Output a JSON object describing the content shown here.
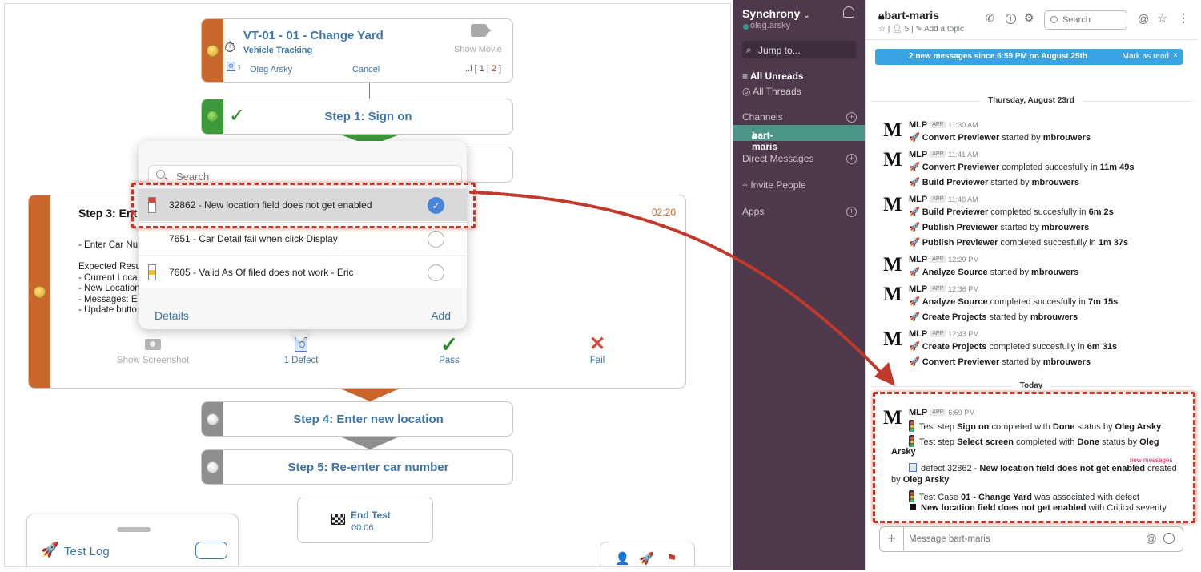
{
  "runner": {
    "test_card": {
      "title": "VT-01 - 01 - Change Yard",
      "subtitle": "Vehicle Tracking",
      "show_movie": "Show Movie",
      "defect_count": "1",
      "user": "Oleg Arsky",
      "cancel": "Cancel",
      "pages_prefix": "..l [ 1 | ",
      "pages_current": "2",
      "pages_suffix": " ]"
    },
    "steps": {
      "step1": "Step 1: Sign on",
      "step3_title": "Step 3: Ent",
      "step3_time": "02:20",
      "step3_body": "- Enter Car Nu\n\nExpected Resu\n- Current Loca\n- New Location\n- Messages: E\n- Update butto",
      "step4": "Step 4: Enter new location",
      "step5": "Step 5: Re-enter car number"
    },
    "actions": {
      "screenshot": "Show Screenshot",
      "defect": "1 Defect",
      "pass": "Pass",
      "fail": "Fail"
    },
    "end_test": {
      "label": "End Test",
      "time": "00:06"
    },
    "test_log": "Test Log",
    "popover": {
      "search_placeholder": "Search",
      "defects": [
        {
          "text": "32862 - New location field does not get enabled",
          "flag": "red",
          "selected": true
        },
        {
          "text": "7651 - Car Detail fail when click Display",
          "flag": "none",
          "selected": false
        },
        {
          "text": "7605 - Valid As Of filed does not work - Eric",
          "flag": "yellow",
          "selected": false
        }
      ],
      "details": "Details",
      "add": "Add"
    }
  },
  "slack": {
    "workspace": "Synchrony",
    "workspace_caret": "⌄",
    "user": "oleg.arsky",
    "jump_to": "Jump to...",
    "nav": {
      "unreads": "All Unreads",
      "threads": "All Threads"
    },
    "sections": {
      "channels": "Channels",
      "dms": "Direct Messages",
      "invite": "Invite People",
      "apps": "Apps"
    },
    "active_channel": "bart-maris",
    "channel": {
      "name": "bart-maris",
      "members": "5",
      "add_topic": "Add a topic"
    },
    "search_placeholder": "Search",
    "banner": {
      "text": "2 new messages since 6:59 PM on August 25th",
      "mark": "Mark as read",
      "close": "×"
    },
    "days": {
      "thursday": "Thursday, August 23rd",
      "today": "Today"
    },
    "author": "MLP",
    "app_badge": "APP",
    "messages": [
      {
        "time": "11:30 AM",
        "lines": [
          {
            "b1": "Convert Previewer",
            "t1": " started by ",
            "b2": "mbrouwers"
          }
        ]
      },
      {
        "time": "11:41 AM",
        "lines": [
          {
            "b1": "Convert Previewer",
            "t1": " completed succesfully in ",
            "b2": "11m 49s"
          },
          {
            "b1": "Build Previewer",
            "t1": " started by ",
            "b2": "mbrouwers"
          }
        ]
      },
      {
        "time": "11:48 AM",
        "lines": [
          {
            "b1": "Build Previewer",
            "t1": " completed succesfully in ",
            "b2": "6m 2s"
          },
          {
            "b1": "Publish Previewer",
            "t1": " started by ",
            "b2": "mbrouwers"
          },
          {
            "b1": "Publish Previewer",
            "t1": " completed succesfully in ",
            "b2": "1m 37s"
          }
        ]
      },
      {
        "time": "12:29 PM",
        "lines": [
          {
            "b1": "Analyze Source",
            "t1": " started by ",
            "b2": "mbrouwers"
          }
        ]
      },
      {
        "time": "12:36 PM",
        "lines": [
          {
            "b1": "Analyze Source",
            "t1": " completed succesfully in ",
            "b2": "7m 15s"
          },
          {
            "b1": "Create Projects",
            "t1": " started by ",
            "b2": "mbrouwers"
          }
        ]
      },
      {
        "time": "12:43 PM",
        "lines": [
          {
            "b1": "Create Projects",
            "t1": " completed succesfully in ",
            "b2": "6m 31s"
          },
          {
            "b1": "Convert Previewer",
            "t1": " started by ",
            "b2": "mbrouwers"
          }
        ]
      }
    ],
    "today_message": {
      "time": "6:59 PM",
      "l1": {
        "a": "Test step ",
        "b": "Sign on",
        "c": " completed with ",
        "d": "Done",
        "e": " status by ",
        "f": "Oleg Arsky"
      },
      "l2": {
        "a": "Test step ",
        "b": "Select screen",
        "c": " completed with ",
        "d": "Done",
        "e": " status by ",
        "f": "Oleg"
      },
      "l2b": "Arsky",
      "l3": {
        "a": "defect 32862 - ",
        "b": "New location field does not get enabled",
        "c": " created"
      },
      "l3b": {
        "a": "by ",
        "b": "Oleg Arsky"
      },
      "l4": {
        "a": "Test Case ",
        "b": "01 - Change Yard",
        "c": " was associated with defect"
      },
      "l5": {
        "b": "New location field does not get enabled",
        "c": " with Critical severity"
      }
    },
    "new_messages": "new messages",
    "composer_placeholder": "Message bart-maris"
  },
  "colors": {
    "accent_red": "#c0392b",
    "link_blue": "#3d75a8",
    "slack_sidebar": "#4d394b",
    "slack_active": "#4c9689",
    "banner": "#3aa3e3"
  }
}
